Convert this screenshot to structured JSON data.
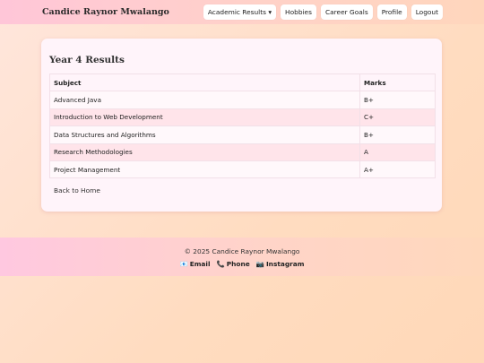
{
  "header": {
    "brand": "Candice Raynor Mwalango",
    "nav": {
      "academic": "Academic Results ▾",
      "hobbies": "Hobbies",
      "career": "Career Goals",
      "profile": "Profile",
      "logout": "Logout"
    }
  },
  "main": {
    "title": "Year 4 Results",
    "table": {
      "headers": {
        "subject": "Subject",
        "marks": "Marks"
      },
      "rows": [
        {
          "subject": "Advanced Java",
          "mark": "B+"
        },
        {
          "subject": "Introduction to Web Development",
          "mark": "C+"
        },
        {
          "subject": "Data Structures and Algorithms",
          "mark": "B+"
        },
        {
          "subject": "Research Methodologies",
          "mark": "A"
        },
        {
          "subject": "Project Management",
          "mark": "A+"
        }
      ]
    },
    "back_link": "Back to Home"
  },
  "footer": {
    "copyright": "© 2025 Candice Raynor Mwalango",
    "links": {
      "email_icon": "📧",
      "email": "Email",
      "phone_icon": "📞",
      "phone": "Phone",
      "instagram_icon": "📷",
      "instagram": "Instagram"
    }
  }
}
